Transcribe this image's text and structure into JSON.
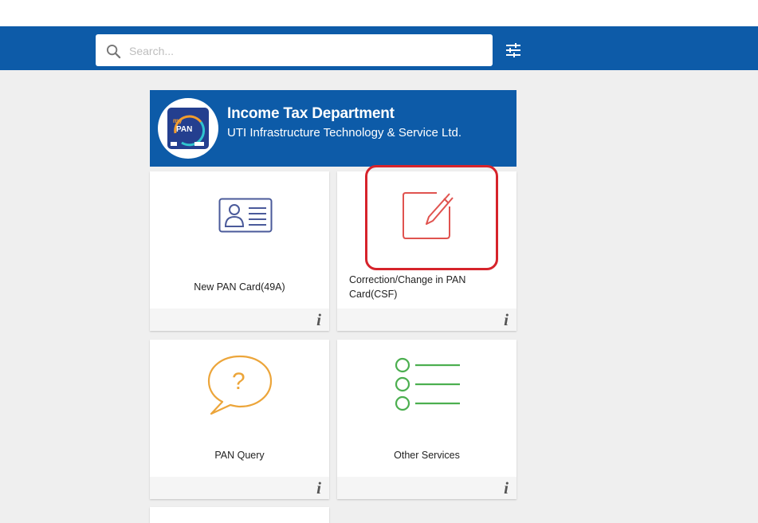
{
  "search": {
    "placeholder": "Search..."
  },
  "brand": {
    "title": "Income Tax Department",
    "subtitle": "UTI Infrastructure Technology & Service Ltd.",
    "logo_text_my": "my",
    "logo_text_pan": "PAN"
  },
  "cards": [
    {
      "label": "New PAN Card(49A)",
      "icon": "id-card-icon",
      "info": "i"
    },
    {
      "label": "Correction/Change in PAN Card(CSF)",
      "icon": "edit-icon",
      "info": "i"
    },
    {
      "label": "PAN Query",
      "icon": "question-bubble-icon",
      "info": "i"
    },
    {
      "label": "Other Services",
      "icon": "list-icon",
      "info": "i"
    }
  ],
  "colors": {
    "header": "#0d5ba8",
    "id_card": "#4a5a9a",
    "edit": "#e0534f",
    "query": "#eca53a",
    "list": "#4caf50",
    "highlight": "#d6232b"
  }
}
